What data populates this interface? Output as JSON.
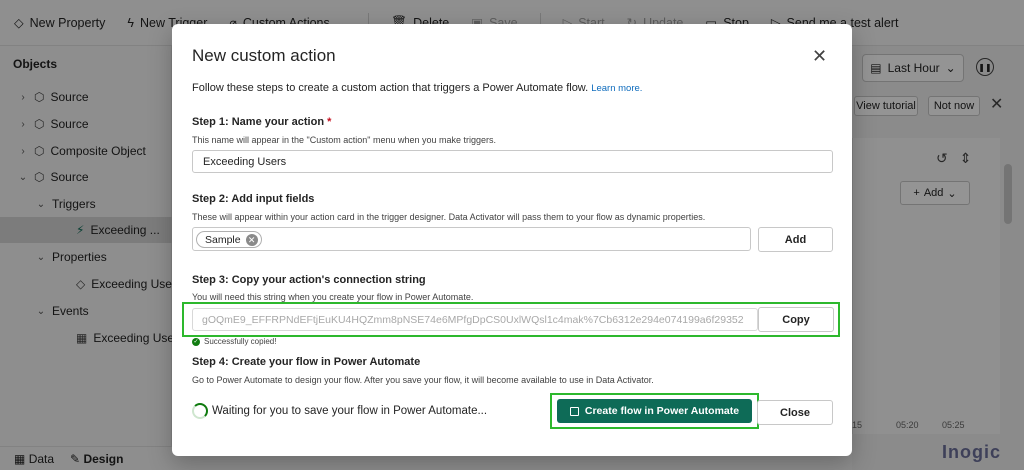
{
  "toolbar": {
    "items": [
      {
        "label": "New Property",
        "icon": "tag-icon"
      },
      {
        "label": "New Trigger",
        "icon": "lightning-icon"
      },
      {
        "label": "Custom Actions",
        "icon": "custom-action-icon"
      },
      {
        "label": "Delete",
        "icon": "delete-icon"
      },
      {
        "label": "Save",
        "icon": "save-icon"
      },
      {
        "label": "Start",
        "icon": "play-icon"
      },
      {
        "label": "Update",
        "icon": "update-icon"
      },
      {
        "label": "Stop",
        "icon": "stop-icon"
      },
      {
        "label": "Send me a test alert",
        "icon": "send-icon"
      }
    ]
  },
  "sidebar": {
    "title": "Objects",
    "tree": [
      {
        "label": "Source",
        "chevron": "›",
        "icon": "⬡"
      },
      {
        "label": "Source",
        "chevron": "›",
        "icon": "⬡"
      },
      {
        "label": "Composite Object",
        "chevron": "›",
        "icon": "⬡"
      },
      {
        "label": "Source",
        "chevron": "⌄",
        "icon": "⬡"
      },
      {
        "label": "Triggers",
        "chevron": "⌄",
        "icon": ""
      },
      {
        "label": "Exceeding ...",
        "chevron": "",
        "icon": "⚡"
      },
      {
        "label": "Properties",
        "chevron": "⌄",
        "icon": ""
      },
      {
        "label": "Exceeding Users",
        "chevron": "",
        "icon": "◇"
      },
      {
        "label": "Events",
        "chevron": "⌄",
        "icon": ""
      },
      {
        "label": "Exceeding Users",
        "chevron": "",
        "icon": "▦"
      }
    ],
    "bottom_tabs": [
      "Data",
      "Design"
    ]
  },
  "right_pane": {
    "time_range": "Last Hour",
    "view_tutorial": "View tutorial",
    "not_now": "Not now",
    "add_label": "Add",
    "ticks": [
      "15",
      "05:20",
      "05:25"
    ],
    "logo": "Inogic"
  },
  "dialog": {
    "title": "New custom action",
    "intro": "Follow these steps to create a custom action that triggers a Power Automate flow.",
    "learn_more": "Learn more.",
    "step1": {
      "title": "Step 1: Name your action",
      "required_mark": "*",
      "description": "This name will appear in the \"Custom action\" menu when you make triggers.",
      "value": "Exceeding Users"
    },
    "step2": {
      "title": "Step 2: Add input fields",
      "description": "These will appear within your action card in the trigger designer. Data Activator will pass them to your flow as dynamic properties.",
      "tags": [
        "Sample"
      ],
      "add_button": "Add"
    },
    "step3": {
      "title": "Step 3: Copy your action's connection string",
      "description": "You will need this string when you create your flow in Power Automate.",
      "connection_string": "gOQmE9_EFFRPNdEFtjEuKU4HQZmm8pNSE74e6MPfgDpCS0UxlWQsl1c4mak%7Cb6312e294e074199a6f29352",
      "copy_button": "Copy",
      "copied_message": "Successfully copied!"
    },
    "step4": {
      "title": "Step 4: Create your flow in Power Automate",
      "description": "Go to Power Automate to design your flow. After you save your flow, it will become available to use in Data Activator.",
      "waiting": "Waiting for you to save your flow in Power Automate...",
      "create_button": "Create flow in Power Automate",
      "close_button": "Close"
    },
    "colors": {
      "primary": "#0e6b57",
      "highlight": "#2db82d",
      "required": "#c50f1f",
      "link": "#0f6cbd"
    }
  }
}
